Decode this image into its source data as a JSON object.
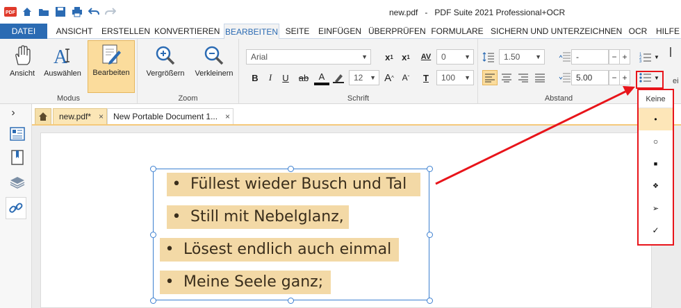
{
  "window": {
    "document_name": "new.pdf",
    "separator": "-",
    "app_name": "PDF Suite 2021 Professional+OCR",
    "logo_text": "PDF"
  },
  "menu": {
    "tabs": [
      "DATEI",
      "ANSICHT",
      "ERSTELLEN",
      "KONVERTIEREN",
      "BEARBEITEN",
      "SEITE",
      "EINFÜGEN",
      "ÜBERPRÜFEN",
      "FORMULARE",
      "SICHERN UND UNTERZEICHNEN",
      "OCR",
      "HILFE"
    ],
    "active_index": 4
  },
  "ribbon": {
    "modus": {
      "label": "Modus",
      "buttons": [
        "Ansicht",
        "Auswählen",
        "Bearbeiten"
      ]
    },
    "zoom": {
      "label": "Zoom",
      "buttons": [
        "Vergrößern",
        "Verkleinern"
      ]
    },
    "schrift": {
      "label": "Schrift",
      "font": "Arial",
      "size": "12",
      "char_spacing": "0",
      "char_scale": "100",
      "bold": "B",
      "italic": "I",
      "underline": "U",
      "strike": "ab",
      "font_color": "A",
      "grow": "A",
      "shrink": "A",
      "superscript": "x",
      "subscript": "x",
      "superscript_mark": "1",
      "subscript_mark": "1",
      "av_label": "AV",
      "t_label": "T"
    },
    "abstand": {
      "label": "Abstand",
      "line_spacing": "1.50",
      "before": "-",
      "after": "5.00",
      "minus": "−",
      "plus": "+",
      "cut_label": "ei"
    }
  },
  "doc_tabs": [
    {
      "label": "new.pdf*",
      "active": true
    },
    {
      "label": "New Portable Document 1...",
      "active": false
    }
  ],
  "close_glyph": "×",
  "rail_toggle": "›",
  "document": {
    "lines": [
      {
        "bullet": "•",
        "text": "Füllest wieder Busch und Tal"
      },
      {
        "bullet": "•",
        "text": "Still mit Nebelglanz,"
      },
      {
        "bullet": "•",
        "text": "Lösest endlich auch einmal"
      },
      {
        "bullet": "•",
        "text": "Meine Seele ganz;"
      }
    ]
  },
  "bullet_dropdown": {
    "header": "Keine",
    "options": [
      "•",
      "○",
      "■",
      "❖",
      "➢",
      "✓"
    ],
    "highlighted": 0
  },
  "colors": {
    "accent": "#2b6bb3",
    "highlight": "#f3d9a6",
    "callout": "#e8141a",
    "selection": "#fbdc9c"
  }
}
